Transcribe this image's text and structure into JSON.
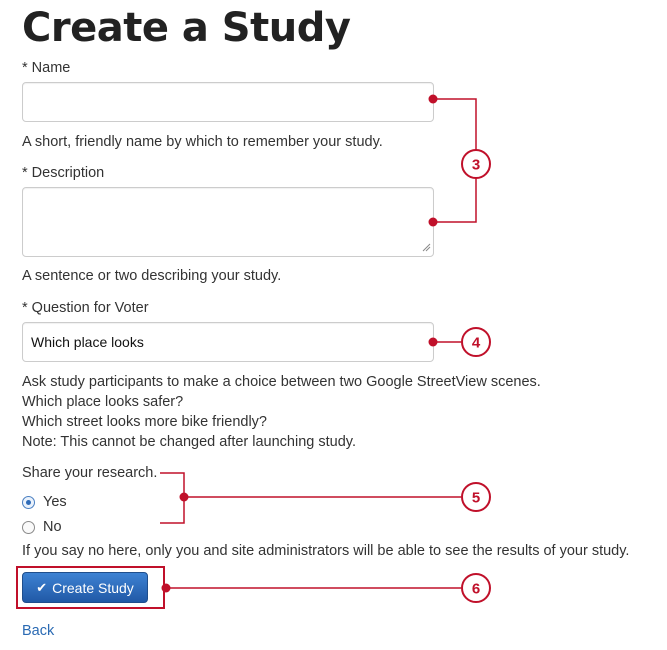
{
  "page": {
    "title": "Create a Study"
  },
  "form": {
    "name": {
      "label": "* Name",
      "value": "",
      "help": "A short, friendly name by which to remember your study."
    },
    "description": {
      "label": "* Description",
      "value": "",
      "help": "A sentence or two describing your study."
    },
    "question": {
      "label": "* Question for Voter",
      "value": "Which place looks",
      "help": [
        "Ask study participants to make a choice between two Google StreetView scenes.",
        "Which place looks safer?",
        "Which street looks more bike friendly?",
        "Note: This cannot be changed after launching study."
      ]
    },
    "share": {
      "label": "Share your research.",
      "options": [
        {
          "label": "Yes",
          "checked": true
        },
        {
          "label": "No",
          "checked": false
        }
      ],
      "help": "If you say no here, only you and site administrators will be able to see the results of your study."
    },
    "submit_label": "Create Study",
    "submit_icon": "check-icon",
    "back_label": "Back"
  },
  "callouts": [
    "3",
    "4",
    "5",
    "6"
  ],
  "colors": {
    "annotation": "#c0102a",
    "primary": "#2a6ab3",
    "link": "#2a6ab3"
  }
}
